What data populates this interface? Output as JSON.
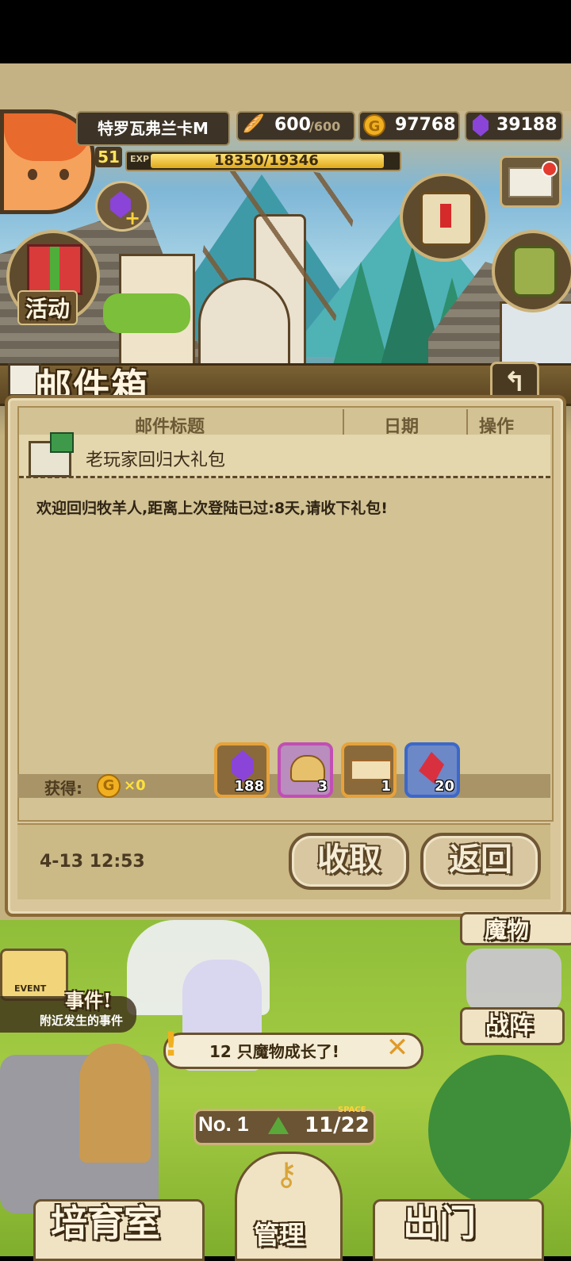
{
  "hud": {
    "player_name": "特罗瓦弗兰卡M",
    "level": "51",
    "exp_label": "EXP",
    "exp_text": "18350/19346",
    "exp_progress": 0.948,
    "stamina_value": "600",
    "stamina_max": "/600",
    "gold": "97768",
    "gems": "39188"
  },
  "side_buttons": {
    "event_label": "活动"
  },
  "mailbox": {
    "title": "邮件箱",
    "columns": [
      "邮件标题",
      "日期",
      "操作"
    ],
    "mail_title": "老玩家回归大礼包",
    "mail_body": "欢迎回归牧羊人,距离上次登陆已过:8天,请收下礼包!",
    "obtain_label": "获得:",
    "gold_count": "×0",
    "rewards": [
      {
        "icon": "purple-gem-icon",
        "count": "188",
        "border": "#e7a23a"
      },
      {
        "icon": "gold-helmet-icon",
        "count": "3",
        "border": "#c04fb5"
      },
      {
        "icon": "ticket-icon",
        "count": "1",
        "border": "#e7a23a"
      },
      {
        "icon": "red-crystal-icon",
        "count": "20",
        "border": "#3c68c9"
      }
    ],
    "date": "4-13 12:53",
    "collect_label": "收取",
    "back_label": "返回"
  },
  "bottom": {
    "monster_tab": "魔物",
    "event_badge": "EVENT",
    "event_title": "事件!",
    "event_subtitle": "附近发生的事件",
    "formation_label": "战阵",
    "notice_text": "12 只魔物成长了!",
    "space_label": "SPACE",
    "farm_no": "No. 1",
    "capacity": "11/22",
    "breeding_label": "培育室",
    "manage_label": "管理",
    "exit_label": "出门"
  }
}
